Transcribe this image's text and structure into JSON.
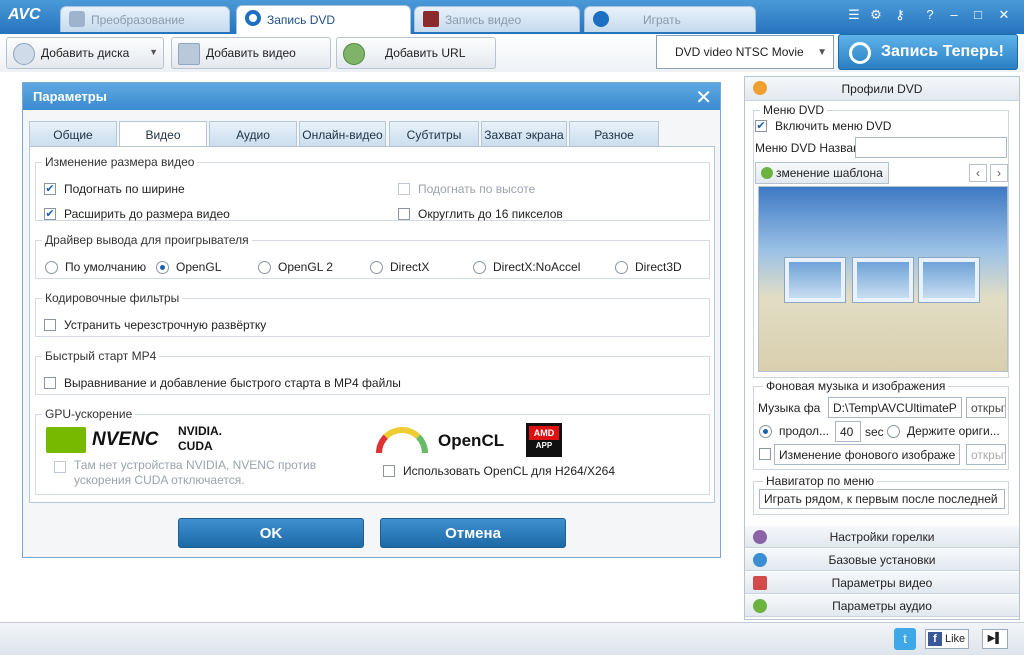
{
  "app": {
    "logo": "AVC"
  },
  "tabs": [
    {
      "label": "Преобразование",
      "icon": "convert-icon"
    },
    {
      "label": "Запись DVD",
      "icon": "dvd-icon"
    },
    {
      "label": "Запись видео",
      "icon": "record-icon"
    },
    {
      "label": "Играть",
      "icon": "play-icon"
    }
  ],
  "toolbar": {
    "add_disc": "Добавить диска",
    "add_video": "Добавить видео",
    "add_url": "Добавить URL",
    "profile": "DVD video NTSC Movie",
    "burn": "Запись Теперь!"
  },
  "dialog": {
    "title": "Параметры",
    "tabs": [
      "Общие",
      "Видео",
      "Аудио",
      "Онлайн-видео",
      "Субтитры",
      "Захват экрана",
      "Разное"
    ],
    "resize": {
      "legend": "Изменение размера видео",
      "fit_width": "Подогнать по ширине",
      "expand": "Расширить до размера видео",
      "fit_height": "Подогнать по высоте",
      "round16": "Округлить до 16 пикселов"
    },
    "driver": {
      "legend": "Драйвер вывода для проигрывателя",
      "options": [
        "По умолчанию",
        "OpenGL",
        "OpenGL 2",
        "DirectX",
        "DirectX:NoAccel",
        "Direct3D"
      ],
      "selected": "OpenGL"
    },
    "filters": {
      "legend": "Кодировочные фильтры",
      "deinterlace": "Устранить черезстрочную развёртку"
    },
    "mp4": {
      "legend": "Быстрый старт MP4",
      "align": "Выравнивание и добавление быстрого старта в MP4 файлы"
    },
    "gpu": {
      "legend": "GPU-ускорение",
      "nvenc": "NVENC",
      "nvidia": "NVIDIA.",
      "cuda": "CUDA",
      "opencl": "OpenCL",
      "amd": "AMD",
      "app": "APP",
      "no_nvidia": "Там нет устройства NVIDIA, NVENC против ускорения CUDA отключается.",
      "use_opencl": "Использовать OpenCL для H264/X264"
    },
    "ok": "OK",
    "cancel": "Отмена"
  },
  "right": {
    "header": "Профили DVD",
    "menu_dvd": "Меню DVD",
    "enable_menu": "Включить меню DVD",
    "menu_name_label": "Меню DVD Назван",
    "change_template": "зменение шаблона",
    "music_group": "Фоновая музыка и изображения",
    "music_label": "Музыка фа",
    "music_path": "D:\\Temp\\AVCUltimateP",
    "open1": "открыто",
    "duration_label": "продол...",
    "duration_value": "40",
    "sec": "sec",
    "keep": "Держите ориги...",
    "change_bg": "Изменение фонового изображе",
    "open2": "открыто",
    "nav_group": "Навигатор по меню",
    "nav_value": "Играть рядом, к первым после последней",
    "sections": [
      "Настройки горелки",
      "Базовые установки",
      "Параметры видео",
      "Параметры аудио"
    ]
  },
  "status": {
    "like": "Like"
  },
  "colors": {
    "accent": "#2a7fc3",
    "title": "#3b8acf"
  }
}
